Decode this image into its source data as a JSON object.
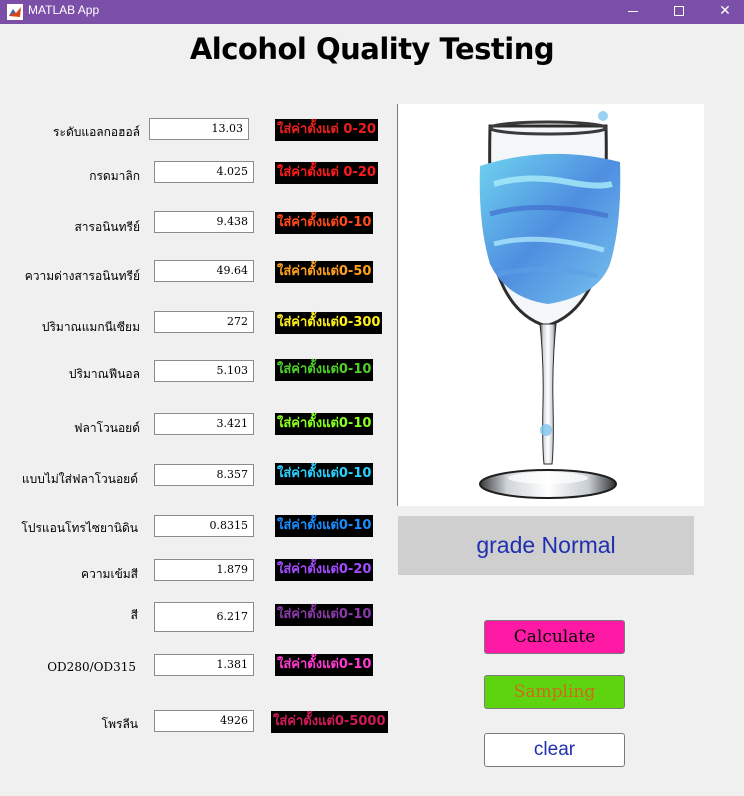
{
  "window": {
    "title": "MATLAB App",
    "minimize_label": "─",
    "close_label": "✕"
  },
  "app_title": "Alcohol Quality Testing",
  "rows": [
    {
      "label": "ระดับแอลกอฮอล์",
      "value": "13.03",
      "hint": "ใส่ค่าตั้งแต่  0-20",
      "hint_color": "#e8201e"
    },
    {
      "label": "กรดมาลิก",
      "value": "4.025",
      "hint": "ใส่ค่าตั้งแต่  0-20",
      "hint_color": "#ff1a1a"
    },
    {
      "label": "สารอนินทรีย์",
      "value": "9.438",
      "hint": "ใส่ค่าตั้งแต่0-10",
      "hint_color": "#ff4a1a"
    },
    {
      "label": "ความด่างสารอนินทรีย์",
      "value": "49.64",
      "hint": "ใส่ค่าตั้งแต่0-50",
      "hint_color": "#ffa020"
    },
    {
      "label": "ปริมาณแมกนีเซียม",
      "value": "272",
      "hint": "ใส่ค่าตั้งแต่0-300",
      "hint_color": "#fff01a"
    },
    {
      "label": "ปริมาณฟีนอล",
      "value": "5.103",
      "hint": "ใส่ค่าตั้งแต่0-10",
      "hint_color": "#4ed02a"
    },
    {
      "label": "ฟลาโวนอยด์",
      "value": "3.421",
      "hint": "ใส่ค่าตั้งแต่0-10",
      "hint_color": "#8aff20"
    },
    {
      "label": "แบบไม่ใส่ฟลาโวนอยด์",
      "value": "8.357",
      "hint": "ใส่ค่าตั้งแต่0-10",
      "hint_color": "#2ad0ff"
    },
    {
      "label": "โปรแอนโทรไซยานิดิน",
      "value": "0.8315",
      "hint": "ใส่ค่าตั้งแต่0-10",
      "hint_color": "#1a8cff"
    },
    {
      "label": "ความเข้มสี",
      "value": "1.879",
      "hint": "ใส่ค่าตั้งแต่0-20",
      "hint_color": "#a44cff"
    },
    {
      "label": "สี",
      "value": "6.217",
      "hint": "ใส่ค่าตั้งแต่0-10",
      "hint_color": "#8a3aa8"
    },
    {
      "label": "OD280/OD315",
      "value": "1.381",
      "hint": "ใส่ค่าตั้งแต่0-10",
      "hint_color": "#ff3ad0"
    },
    {
      "label": "โพรลีน",
      "value": "4926",
      "hint": "ใส่ค่าตั้งแต่0-5000",
      "hint_color": "#d01a5a"
    }
  ],
  "result": "grade Normal",
  "buttons": {
    "calculate": "Calculate",
    "sampling": "Sampling",
    "clear": "clear"
  },
  "image": {
    "icon": "wine-glass-image"
  }
}
